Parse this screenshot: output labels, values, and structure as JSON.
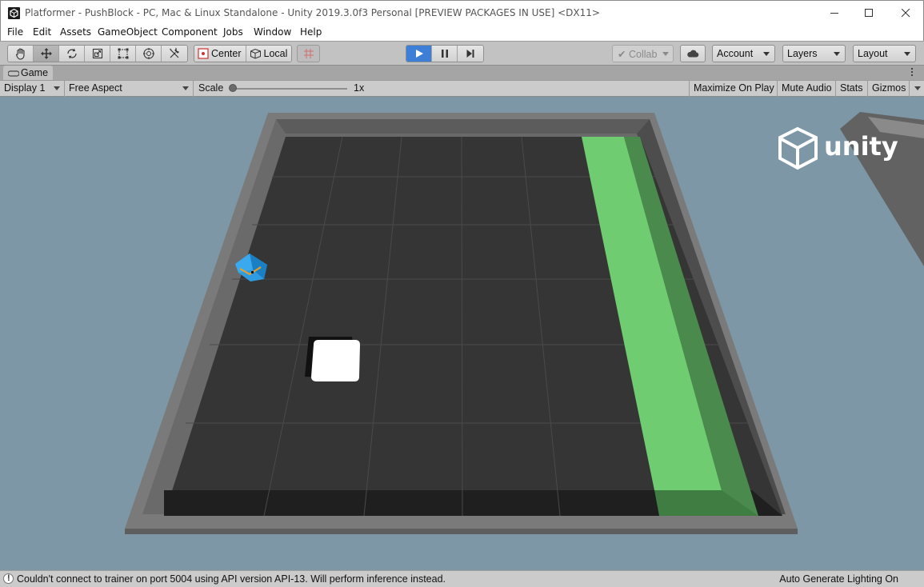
{
  "window": {
    "title": "Platformer - PushBlock - PC, Mac & Linux Standalone - Unity 2019.3.0f3 Personal [PREVIEW PACKAGES IN USE] <DX11>"
  },
  "menu": {
    "items": [
      "File",
      "Edit",
      "Assets",
      "GameObject",
      "Component",
      "Jobs",
      "Window",
      "Help"
    ]
  },
  "toolbar": {
    "tools": [
      "hand-tool-icon",
      "move-tool-icon",
      "rotate-tool-icon",
      "scale-tool-icon",
      "rect-tool-icon",
      "transform-tool-icon",
      "custom-tool-icon"
    ],
    "active_tool": "move-tool-icon",
    "pivot_label": "Center",
    "space_label": "Local",
    "collab_label": "Collab",
    "account_label": "Account",
    "layers_label": "Layers",
    "layout_label": "Layout",
    "play_state": "playing"
  },
  "game_view": {
    "tab_label": "Game",
    "display": "Display 1",
    "aspect": "Free Aspect",
    "scale_label": "Scale",
    "scale_value": "1x",
    "maximize_label": "Maximize On Play",
    "mute_label": "Mute Audio",
    "stats_label": "Stats",
    "gizmos_label": "Gizmos",
    "watermark": "unity"
  },
  "status": {
    "message": "Couldn't connect to trainer on port 5004 using API version API-13. Will perform inference instead.",
    "right": "Auto Generate Lighting On"
  },
  "colors": {
    "sky": "#7d97a6",
    "floor": "#353535",
    "goal": "#6fcc70",
    "agent": "#2f9be0",
    "play_active": "#3d7fd6"
  }
}
